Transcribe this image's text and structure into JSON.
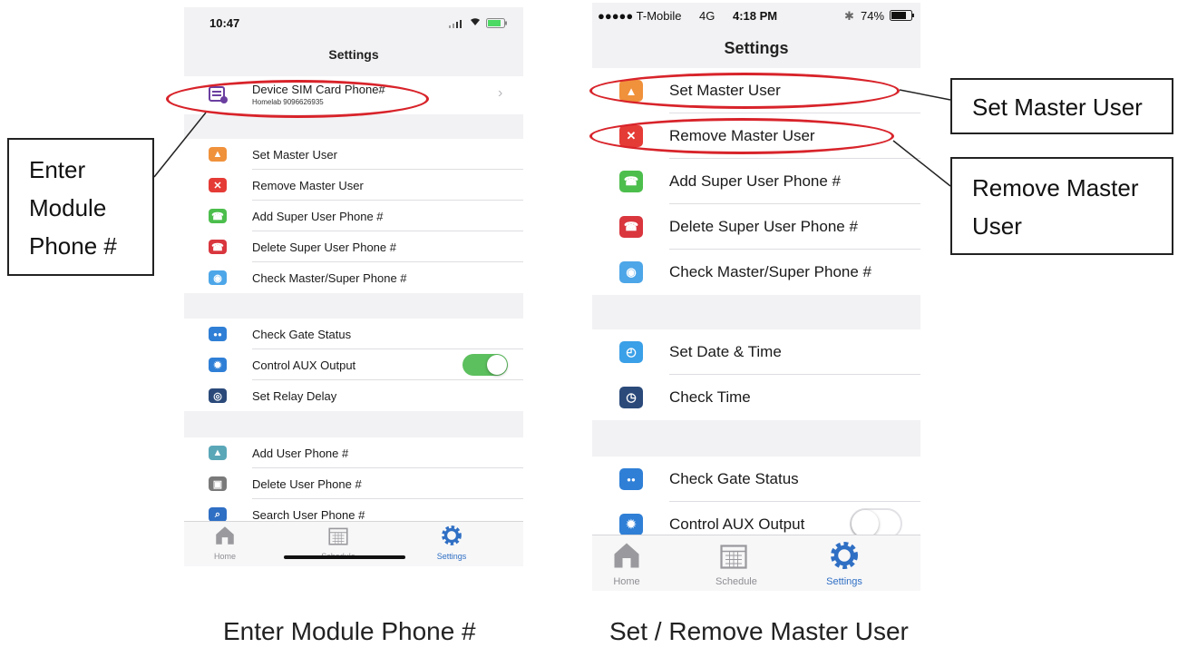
{
  "left_phone": {
    "status": {
      "time": "10:47"
    },
    "title": "Settings",
    "sim_row": {
      "label": "Device SIM Card Phone#",
      "sub": "Homelab 9096626935"
    },
    "group1": [
      {
        "label": "Set Master User",
        "icon": "user-icon",
        "color": "#f0913b"
      },
      {
        "label": "Remove Master User",
        "icon": "close-icon",
        "color": "#e53b36"
      },
      {
        "label": "Add Super User Phone #",
        "icon": "phone-icon",
        "color": "#4cbe4c"
      },
      {
        "label": "Delete Super User Phone #",
        "icon": "phone-delete-icon",
        "color": "#d9363e"
      },
      {
        "label": "Check Master/Super Phone #",
        "icon": "eye-icon",
        "color": "#4da6e8"
      }
    ],
    "group2": [
      {
        "label": "Check Gate Status",
        "icon": "gate-status-icon",
        "color": "#2f7fd6"
      },
      {
        "label": "Control AUX Output",
        "icon": "aux-icon",
        "color": "#2f7fd6",
        "toggle": true
      },
      {
        "label": "Set Relay Delay",
        "icon": "relay-icon",
        "color": "#2b4a7a"
      }
    ],
    "group3": [
      {
        "label": "Add User Phone #",
        "icon": "add-user-icon",
        "color": "#5aa7b8"
      },
      {
        "label": "Delete User Phone #",
        "icon": "delete-user-icon",
        "color": "#7a7a7a"
      },
      {
        "label": "Search User Phone #",
        "icon": "search-icon",
        "color": "#2f6fc4"
      }
    ],
    "tabs": [
      {
        "label": "Home",
        "icon": "home-icon"
      },
      {
        "label": "Schedule",
        "icon": "calendar-icon"
      },
      {
        "label": "Settings",
        "icon": "gear-icon",
        "active": true
      }
    ]
  },
  "right_phone": {
    "status": {
      "carrier": "●●●●● T-Mobile",
      "network": "4G",
      "time": "4:18 PM",
      "battery": "74%"
    },
    "title": "Settings",
    "group1": [
      {
        "label": "Set Master User",
        "icon": "user-icon",
        "color": "#f0913b"
      },
      {
        "label": "Remove Master User",
        "icon": "close-icon",
        "color": "#e53b36"
      },
      {
        "label": "Add Super User Phone #",
        "icon": "phone-icon",
        "color": "#4cbe4c"
      },
      {
        "label": "Delete Super User Phone #",
        "icon": "phone-delete-icon",
        "color": "#d9363e"
      },
      {
        "label": "Check Master/Super Phone #",
        "icon": "eye-icon",
        "color": "#4da6e8"
      }
    ],
    "group2": [
      {
        "label": "Set Date & Time",
        "icon": "clock-icon",
        "color": "#3aa0e8"
      },
      {
        "label": "Check Time",
        "icon": "check-time-icon",
        "color": "#2b4a7a"
      }
    ],
    "group3": [
      {
        "label": "Check Gate Status",
        "icon": "gate-status-icon",
        "color": "#2f7fd6"
      },
      {
        "label": "Control AUX Output",
        "icon": "aux-icon",
        "color": "#2f7fd6",
        "toggle": true
      }
    ],
    "tabs": [
      {
        "label": "Home",
        "icon": "home-icon"
      },
      {
        "label": "Schedule",
        "icon": "calendar-icon"
      },
      {
        "label": "Settings",
        "icon": "gear-icon",
        "active": true
      }
    ]
  },
  "callouts": {
    "enter_module": [
      "Enter",
      "Module",
      "Phone #"
    ],
    "set_master": "Set Master User",
    "remove_master": [
      "Remove Master",
      "User"
    ]
  },
  "captions": {
    "left": "Enter Module Phone #",
    "right": "Set / Remove Master User"
  },
  "colors": {
    "highlight": "#d8232a",
    "toggle_on": "#5cc05e",
    "accent": "#2f6fc4"
  }
}
